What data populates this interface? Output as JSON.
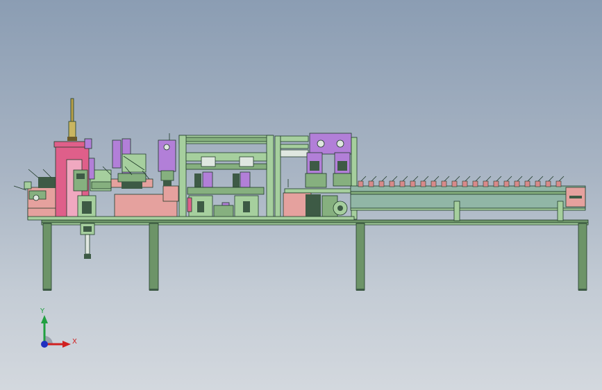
{
  "triad": {
    "y_label": "Y",
    "x_label": "X",
    "y_color": "#20a040",
    "x_color": "#d02020",
    "z_color": "#2030c0"
  },
  "palette": {
    "frame_green": "#5f8a5f",
    "frame_light": "#9fc79a",
    "pink": "#e0608a",
    "salmon": "#e6a3a0",
    "purple": "#b07ed8",
    "conveyor": "#8fb4a4",
    "outline": "#1f3a28"
  }
}
